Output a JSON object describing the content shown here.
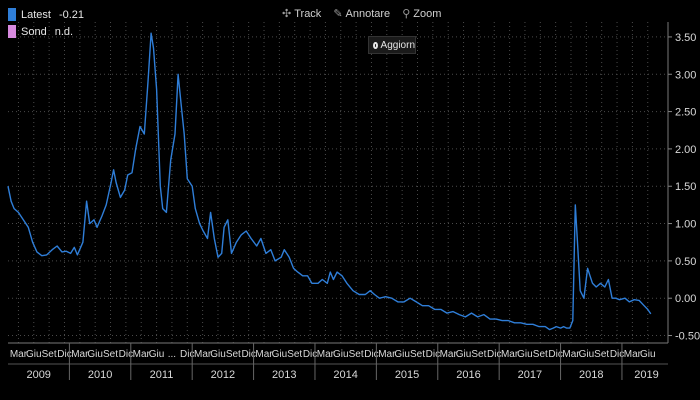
{
  "legend": [
    {
      "label": "Latest",
      "value": "-0.21",
      "color": "#2f7ed8"
    },
    {
      "label": "Sond",
      "value": "n.d.",
      "color": "#d88adf"
    }
  ],
  "toolbar": {
    "track": "Track",
    "annotate": "Annotare",
    "zoom": "Zoom",
    "refresh": "Aggiorn"
  },
  "colors": {
    "background": "#000000",
    "line": "#2f7ed8",
    "grid": "#4a4a4a",
    "text": "#d8d8d8"
  },
  "chart_data": {
    "type": "line",
    "title": "",
    "xlabel": "",
    "ylabel": "",
    "ylim": [
      -0.6,
      3.7
    ],
    "y_ticks": [
      3.5,
      3.0,
      2.5,
      2.0,
      1.5,
      1.0,
      0.5,
      0.0,
      -0.5
    ],
    "y_tick_labels": [
      "3.50",
      "3.00",
      "2.50",
      "2.00",
      "1.50",
      "1.00",
      "0.50",
      "0.00",
      "-0.50"
    ],
    "y_axis_position": "right",
    "grid": true,
    "legend_position": "top-left",
    "x_range": [
      2009.0,
      2019.75
    ],
    "month_ticks": [
      {
        "t": 2009.17,
        "label": "Mar"
      },
      {
        "t": 2009.42,
        "label": "Giu"
      },
      {
        "t": 2009.67,
        "label": "Set"
      },
      {
        "t": 2009.92,
        "label": "Dic"
      },
      {
        "t": 2010.17,
        "label": "Mar"
      },
      {
        "t": 2010.42,
        "label": "Giu"
      },
      {
        "t": 2010.67,
        "label": "Set"
      },
      {
        "t": 2010.92,
        "label": "Dic"
      },
      {
        "t": 2011.17,
        "label": "Mar"
      },
      {
        "t": 2011.42,
        "label": "Giu"
      },
      {
        "t": 2011.67,
        "label": "..."
      },
      {
        "t": 2011.92,
        "label": "Dic"
      },
      {
        "t": 2012.17,
        "label": "Mar"
      },
      {
        "t": 2012.42,
        "label": "Giu"
      },
      {
        "t": 2012.67,
        "label": "Set"
      },
      {
        "t": 2012.92,
        "label": "Dic"
      },
      {
        "t": 2013.17,
        "label": "Mar"
      },
      {
        "t": 2013.42,
        "label": "Giu"
      },
      {
        "t": 2013.67,
        "label": "Set"
      },
      {
        "t": 2013.92,
        "label": "Dic"
      },
      {
        "t": 2014.17,
        "label": "Mar"
      },
      {
        "t": 2014.42,
        "label": "Giu"
      },
      {
        "t": 2014.67,
        "label": "Set"
      },
      {
        "t": 2014.92,
        "label": "Dic"
      },
      {
        "t": 2015.17,
        "label": "Mar"
      },
      {
        "t": 2015.42,
        "label": "Giu"
      },
      {
        "t": 2015.67,
        "label": "Set"
      },
      {
        "t": 2015.92,
        "label": "Dic"
      },
      {
        "t": 2016.17,
        "label": "Mar"
      },
      {
        "t": 2016.42,
        "label": "Giu"
      },
      {
        "t": 2016.67,
        "label": "Set"
      },
      {
        "t": 2016.92,
        "label": "Dic"
      },
      {
        "t": 2017.17,
        "label": "Mar"
      },
      {
        "t": 2017.42,
        "label": "Giu"
      },
      {
        "t": 2017.67,
        "label": "Set"
      },
      {
        "t": 2017.92,
        "label": "Dic"
      },
      {
        "t": 2018.17,
        "label": "Mar"
      },
      {
        "t": 2018.42,
        "label": "Giu"
      },
      {
        "t": 2018.67,
        "label": "Set"
      },
      {
        "t": 2018.92,
        "label": "Dic"
      },
      {
        "t": 2019.17,
        "label": "Mar"
      },
      {
        "t": 2019.42,
        "label": "Giu"
      }
    ],
    "year_labels": [
      {
        "t": 2009.5,
        "label": "2009"
      },
      {
        "t": 2010.5,
        "label": "2010"
      },
      {
        "t": 2011.5,
        "label": "2011"
      },
      {
        "t": 2012.5,
        "label": "2012"
      },
      {
        "t": 2013.5,
        "label": "2013"
      },
      {
        "t": 2014.5,
        "label": "2014"
      },
      {
        "t": 2015.5,
        "label": "2015"
      },
      {
        "t": 2016.5,
        "label": "2016"
      },
      {
        "t": 2017.5,
        "label": "2017"
      },
      {
        "t": 2018.5,
        "label": "2018"
      },
      {
        "t": 2019.4,
        "label": "2019"
      }
    ],
    "year_boundaries": [
      2010,
      2011,
      2012,
      2013,
      2014,
      2015,
      2016,
      2017,
      2018,
      2019
    ],
    "series": [
      {
        "name": "Latest",
        "points": [
          [
            2009.0,
            1.5
          ],
          [
            2009.05,
            1.3
          ],
          [
            2009.1,
            1.2
          ],
          [
            2009.17,
            1.15
          ],
          [
            2009.25,
            1.05
          ],
          [
            2009.33,
            0.95
          ],
          [
            2009.4,
            0.75
          ],
          [
            2009.47,
            0.62
          ],
          [
            2009.55,
            0.57
          ],
          [
            2009.63,
            0.58
          ],
          [
            2009.72,
            0.65
          ],
          [
            2009.8,
            0.7
          ],
          [
            2009.88,
            0.62
          ],
          [
            2009.95,
            0.63
          ],
          [
            2010.02,
            0.6
          ],
          [
            2010.08,
            0.68
          ],
          [
            2010.13,
            0.58
          ],
          [
            2010.22,
            0.75
          ],
          [
            2010.28,
            1.3
          ],
          [
            2010.33,
            1.0
          ],
          [
            2010.4,
            1.05
          ],
          [
            2010.45,
            0.95
          ],
          [
            2010.53,
            1.1
          ],
          [
            2010.6,
            1.25
          ],
          [
            2010.68,
            1.55
          ],
          [
            2010.72,
            1.72
          ],
          [
            2010.76,
            1.55
          ],
          [
            2010.83,
            1.35
          ],
          [
            2010.9,
            1.45
          ],
          [
            2010.95,
            1.65
          ],
          [
            2011.02,
            1.68
          ],
          [
            2011.08,
            2.0
          ],
          [
            2011.15,
            2.3
          ],
          [
            2011.22,
            2.2
          ],
          [
            2011.28,
            2.9
          ],
          [
            2011.33,
            3.55
          ],
          [
            2011.37,
            3.35
          ],
          [
            2011.42,
            2.8
          ],
          [
            2011.48,
            1.5
          ],
          [
            2011.52,
            1.2
          ],
          [
            2011.58,
            1.15
          ],
          [
            2011.65,
            1.85
          ],
          [
            2011.72,
            2.2
          ],
          [
            2011.77,
            3.0
          ],
          [
            2011.82,
            2.6
          ],
          [
            2011.87,
            2.2
          ],
          [
            2011.92,
            1.6
          ],
          [
            2012.0,
            1.5
          ],
          [
            2012.05,
            1.2
          ],
          [
            2012.12,
            1.0
          ],
          [
            2012.18,
            0.9
          ],
          [
            2012.25,
            0.8
          ],
          [
            2012.3,
            1.15
          ],
          [
            2012.36,
            0.8
          ],
          [
            2012.42,
            0.55
          ],
          [
            2012.48,
            0.6
          ],
          [
            2012.52,
            0.95
          ],
          [
            2012.58,
            1.05
          ],
          [
            2012.64,
            0.6
          ],
          [
            2012.72,
            0.75
          ],
          [
            2012.8,
            0.85
          ],
          [
            2012.88,
            0.9
          ],
          [
            2012.96,
            0.8
          ],
          [
            2013.05,
            0.7
          ],
          [
            2013.12,
            0.8
          ],
          [
            2013.2,
            0.6
          ],
          [
            2013.28,
            0.65
          ],
          [
            2013.35,
            0.5
          ],
          [
            2013.45,
            0.55
          ],
          [
            2013.5,
            0.65
          ],
          [
            2013.58,
            0.55
          ],
          [
            2013.65,
            0.4
          ],
          [
            2013.72,
            0.35
          ],
          [
            2013.8,
            0.3
          ],
          [
            2013.88,
            0.3
          ],
          [
            2013.95,
            0.2
          ],
          [
            2014.05,
            0.2
          ],
          [
            2014.12,
            0.25
          ],
          [
            2014.2,
            0.2
          ],
          [
            2014.25,
            0.35
          ],
          [
            2014.3,
            0.25
          ],
          [
            2014.36,
            0.35
          ],
          [
            2014.44,
            0.3
          ],
          [
            2014.52,
            0.2
          ],
          [
            2014.62,
            0.1
          ],
          [
            2014.72,
            0.05
          ],
          [
            2014.82,
            0.05
          ],
          [
            2014.9,
            0.1
          ],
          [
            2014.97,
            0.05
          ],
          [
            2015.05,
            0.0
          ],
          [
            2015.15,
            0.02
          ],
          [
            2015.25,
            0.0
          ],
          [
            2015.35,
            -0.05
          ],
          [
            2015.45,
            -0.05
          ],
          [
            2015.55,
            0.0
          ],
          [
            2015.65,
            -0.05
          ],
          [
            2015.75,
            -0.1
          ],
          [
            2015.85,
            -0.1
          ],
          [
            2015.95,
            -0.15
          ],
          [
            2016.05,
            -0.15
          ],
          [
            2016.15,
            -0.2
          ],
          [
            2016.25,
            -0.18
          ],
          [
            2016.35,
            -0.22
          ],
          [
            2016.45,
            -0.25
          ],
          [
            2016.55,
            -0.2
          ],
          [
            2016.65,
            -0.25
          ],
          [
            2016.75,
            -0.22
          ],
          [
            2016.85,
            -0.28
          ],
          [
            2016.95,
            -0.28
          ],
          [
            2017.05,
            -0.3
          ],
          [
            2017.15,
            -0.3
          ],
          [
            2017.25,
            -0.33
          ],
          [
            2017.35,
            -0.33
          ],
          [
            2017.45,
            -0.35
          ],
          [
            2017.55,
            -0.35
          ],
          [
            2017.65,
            -0.38
          ],
          [
            2017.75,
            -0.38
          ],
          [
            2017.82,
            -0.42
          ],
          [
            2017.88,
            -0.4
          ],
          [
            2017.93,
            -0.38
          ],
          [
            2018.0,
            -0.4
          ],
          [
            2018.05,
            -0.38
          ],
          [
            2018.1,
            -0.4
          ],
          [
            2018.15,
            -0.4
          ],
          [
            2018.2,
            -0.3
          ],
          [
            2018.24,
            1.25
          ],
          [
            2018.28,
            0.7
          ],
          [
            2018.32,
            0.1
          ],
          [
            2018.38,
            0.0
          ],
          [
            2018.44,
            0.4
          ],
          [
            2018.48,
            0.3
          ],
          [
            2018.52,
            0.2
          ],
          [
            2018.58,
            0.15
          ],
          [
            2018.65,
            0.2
          ],
          [
            2018.72,
            0.15
          ],
          [
            2018.78,
            0.25
          ],
          [
            2018.84,
            0.0
          ],
          [
            2018.9,
            0.0
          ],
          [
            2018.96,
            -0.02
          ],
          [
            2019.05,
            0.0
          ],
          [
            2019.12,
            -0.05
          ],
          [
            2019.2,
            -0.02
          ],
          [
            2019.28,
            -0.03
          ],
          [
            2019.36,
            -0.1
          ],
          [
            2019.42,
            -0.15
          ],
          [
            2019.47,
            -0.21
          ]
        ]
      }
    ]
  }
}
